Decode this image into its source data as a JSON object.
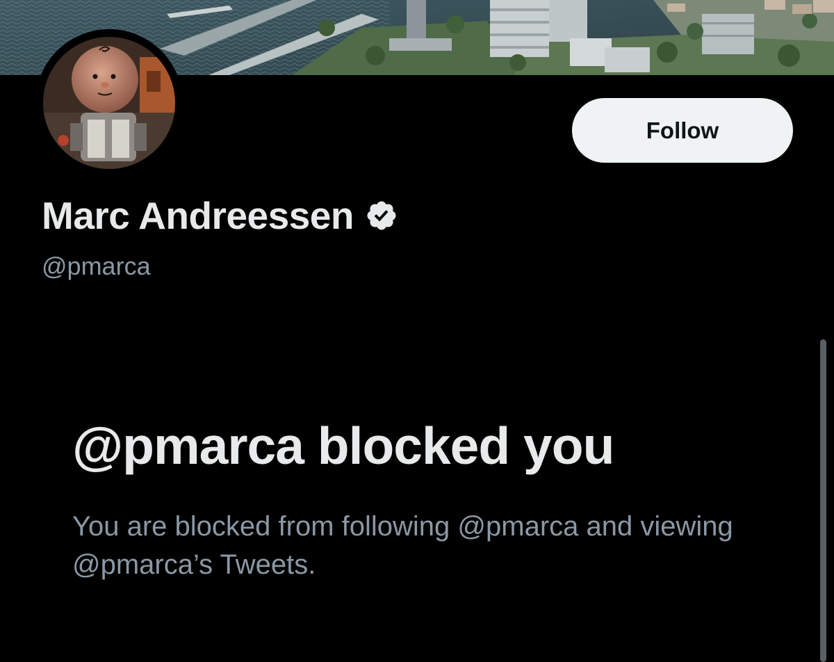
{
  "profile": {
    "display_name": "Marc Andreessen",
    "handle": "@pmarca",
    "verified": true,
    "follow_label": "Follow"
  },
  "blocked": {
    "title": "@pmarca blocked you",
    "description": "You are blocked from following @pmarca and viewing @pmarca’s Tweets."
  },
  "colors": {
    "background": "#000000",
    "primary_text": "#e7e9ea",
    "secondary_text": "#8b98a5",
    "button_bg": "#eff3f4",
    "button_text": "#0f1419"
  },
  "icons": {
    "verified": "verified-badge-icon"
  }
}
